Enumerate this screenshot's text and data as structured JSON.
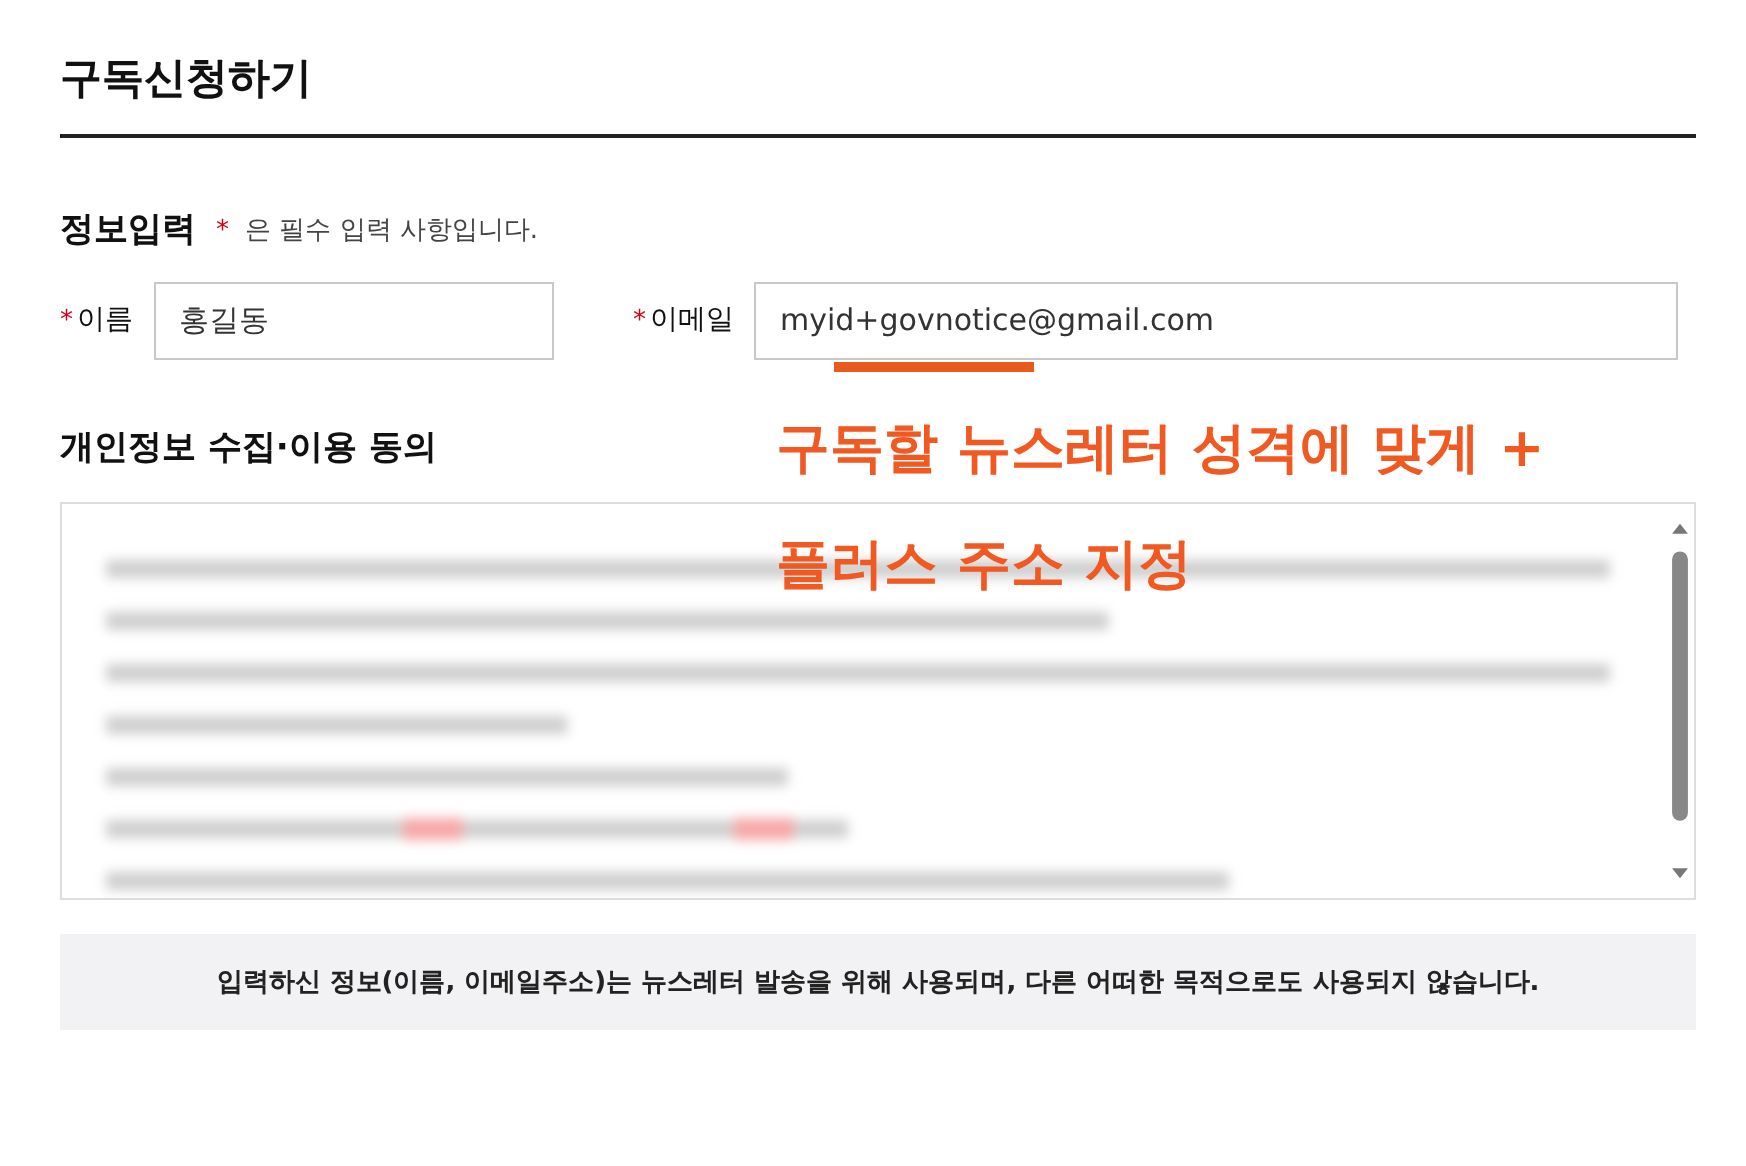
{
  "title": "구독신청하기",
  "section": {
    "title": "정보입력",
    "required_mark": "*",
    "required_note": "은 필수 입력 사항입니다."
  },
  "fields": [
    {
      "label": "이름",
      "required_mark": "*",
      "value": "홍길동"
    },
    {
      "label": "이메일",
      "required_mark": "*",
      "value": "myid+govnotice@gmail.com"
    }
  ],
  "consent": {
    "title": "개인정보 수집·이용 동의"
  },
  "annotation": {
    "lines": [
      "구독할 뉴스레터 성격에 맞게 +",
      "플러스 주소 지정"
    ]
  },
  "notice": "입력하신 정보(이름, 이메일주소)는 뉴스레터 발송을 위해 사용되며, 다른 어떠한 목적으로도 사용되지 않습니다."
}
